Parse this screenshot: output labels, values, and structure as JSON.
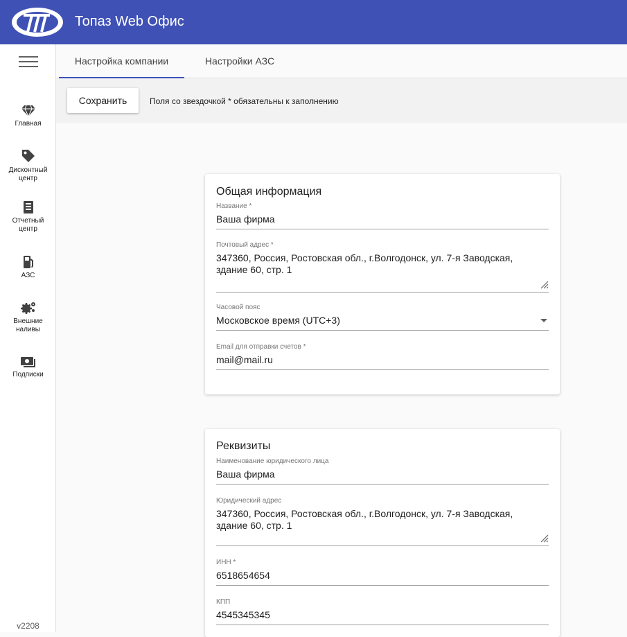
{
  "app": {
    "title": "Топаз Web Офис"
  },
  "sidebar": {
    "items": [
      {
        "label": "Главная",
        "icon": "diamond-icon"
      },
      {
        "label": "Дисконтный центр",
        "icon": "tag-icon"
      },
      {
        "label": "Отчетный центр",
        "icon": "report-icon"
      },
      {
        "label": "АЗС",
        "icon": "fuel-pump-icon"
      },
      {
        "label": "Внешние наливы",
        "icon": "gears-icon"
      },
      {
        "label": "Подписки",
        "icon": "cash-icon"
      }
    ],
    "version": "v2208"
  },
  "tabs": [
    {
      "label": "Настройка компании",
      "active": true
    },
    {
      "label": "Настройки АЗС",
      "active": false
    }
  ],
  "toolbar": {
    "save_label": "Сохранить",
    "required_note": "Поля со звездочкой * обязательны к заполнению"
  },
  "general": {
    "title": "Общая информация",
    "name": {
      "label": "Название *",
      "value": "Ваша фирма"
    },
    "postal_address": {
      "label": "Почтовый адрес *",
      "value": "347360, Россия, Ростовская обл., г.Волгодонск, ул. 7-я Заводская, здание 60, стр. 1"
    },
    "timezone": {
      "label": "Часовой пояс",
      "value": "Московское время (UTC+3)"
    },
    "email": {
      "label": "Email для отправки счетов *",
      "value": "mail@mail.ru"
    }
  },
  "requisites": {
    "title": "Реквизиты",
    "legal_name": {
      "label": "Наименование юридического лица",
      "value": "Ваша фирма"
    },
    "legal_address": {
      "label": "Юридический адрес",
      "value": "347360, Россия, Ростовская обл., г.Волгодонск, ул. 7-я Заводская, здание 60, стр. 1"
    },
    "inn": {
      "label": "ИНН *",
      "value": "6518654654"
    },
    "kpp": {
      "label": "КПП",
      "value": "4545345345"
    }
  },
  "colors": {
    "primary": "#3f51b5",
    "background": "#fafafa"
  }
}
